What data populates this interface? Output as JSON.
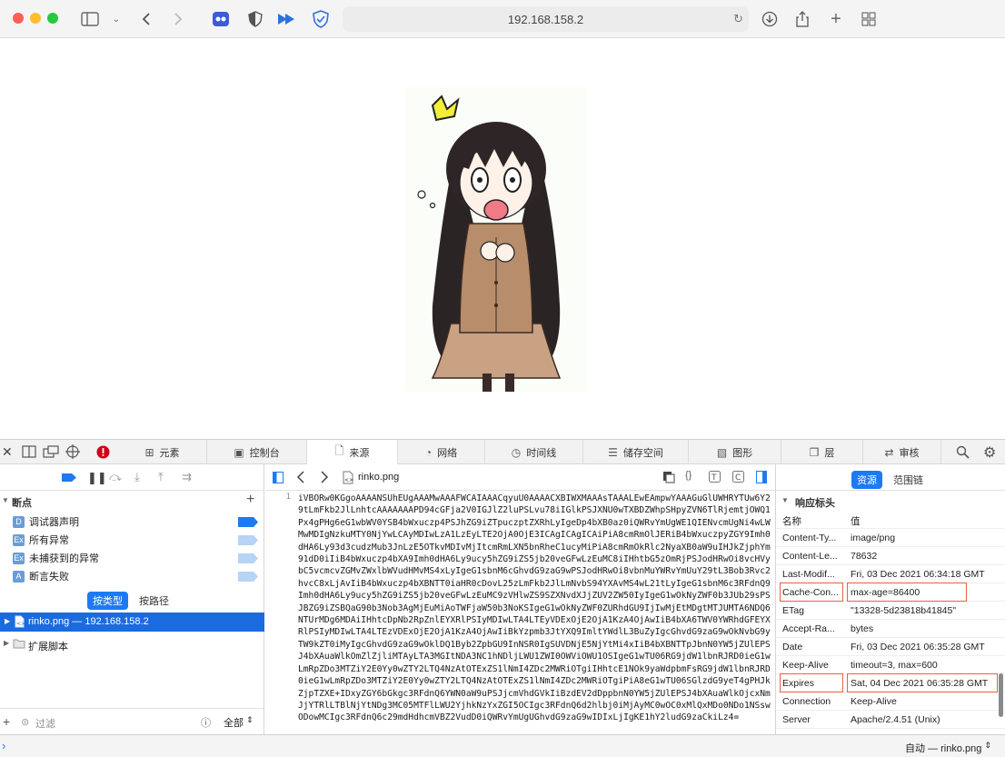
{
  "browser": {
    "url": "192.168.158.2"
  },
  "devtools": {
    "tabs": [
      {
        "label": "元素",
        "icon": "elements-icon"
      },
      {
        "label": "控制台",
        "icon": "console-icon"
      },
      {
        "label": "来源",
        "icon": "sources-icon",
        "active": true
      },
      {
        "label": "网络",
        "icon": "network-icon"
      },
      {
        "label": "时间线",
        "icon": "timeline-icon"
      },
      {
        "label": "储存空间",
        "icon": "storage-icon"
      },
      {
        "label": "图形",
        "icon": "graphics-icon"
      },
      {
        "label": "层",
        "icon": "layers-icon"
      },
      {
        "label": "审核",
        "icon": "audit-icon"
      }
    ],
    "sidebar": {
      "breakpoints_title": "断点",
      "breakpoints": [
        {
          "badge": "D",
          "label": "调试器声明",
          "enabled": true
        },
        {
          "badge": "Ex",
          "label": "所有异常",
          "enabled": false
        },
        {
          "badge": "Ex",
          "label": "未捕获到的异常",
          "enabled": false
        },
        {
          "badge": "A",
          "label": "断言失败",
          "enabled": false
        }
      ],
      "group_by_type": "按类型",
      "group_by_path": "按路径",
      "resource": "rinko.png — 192.168.158.2",
      "extension_scripts": "扩展脚本",
      "filter_placeholder": "过滤",
      "scope": "全部"
    },
    "editor": {
      "filename": "rinko.png",
      "line_number": "1",
      "content": "iVBORw0KGgoAAAANSUhEUgAAAMwAAAFWCAIAAACqyuU0AAAACXBIWXMAAAsTAAALEwEAmpwYAAAGuGlUWHRYTUw6Y29tLmFkb2JlLnhtcAAAAAAAPD94cGFja2V0IGJlZ2luPSLvu78iIGlkPSJXNU0wTXBDZWhpSHpyZVN6TlRjemtjOWQ1Px4gPHg6eG1wbWV0YSB4bWxuczp4PSJhZG9iZTpuczptZXRhLyIgeDp4bXB0az0iQWRvYmUgWE1QIENvcmUgNi4wLWMwMDIgNzkuMTY0NjYwLCAyMDIwLzA1LzEyLTE2OjA0OjE3ICAgICAgICAiPiA8cmRmOlJERiB4bWxuczpyZGY9Imh0dHA6Ly93d3cudzMub3JnLzE5OTkvMDIvMjItcmRmLXN5bnRheC1ucyMiPiA8cmRmOkRlc2NyaXB0aW9uIHJkZjphYm91dD0iIiB4bWxuczp4bXA9Imh0dHA6Ly9ucy5hZG9iZS5jb20veGFwLzEuMC8iIHhtbG5zOmRjPSJodHRwOi8vcHVybC5vcmcvZGMvZWxlbWVudHMvMS4xLyIgeG1sbnM6cGhvdG9zaG9wPSJodHRwOi8vbnMuYWRvYmUuY29tL3Bob3Rvc2hvcC8xLjAvIiB4bWxuczp4bXBNTT0iaHR0cDovL25zLmFkb2JlLmNvbS94YXAvMS4wL21tLyIgeG1sbnM6c3RFdnQ9Imh0dHA6Ly9ucy5hZG9iZS5jb20veGFwLzEuMC9zVHlwZS9SZXNvdXJjZUV2ZW50IyIgeG1wOkNyZWF0b3JUb29sPSJBZG9iZSBQaG90b3Nob3AgMjEuMiAoTWFjaW50b3NoKSIgeG1wOkNyZWF0ZURhdGU9IjIwMjEtMDgtMTJUMTA6NDQ6NTUrMDg6MDAiIHhtcDpNb2RpZnlEYXRlPSIyMDIwLTA4LTEyVDExOjE2OjA1KzA4OjAwIiB4bXA6TWV0YWRhdGFEYXRlPSIyMDIwLTA4LTEzVDExOjE2OjA1KzA4OjAwIiBkYzpmb3JtYXQ9ImltYWdlL3BuZyIgcGhvdG9zaG9wOkNvbG9yTW9kZT0iMyIgcGhvdG9zaG9wOklDQ1Byb2ZpbGU9InNSR0IgSUVDNjE5NjYtMi4xIiB4bXBNTTpJbnN0YW5jZUlEPSJ4bXAuaWlkOmZlZjliMTAyLTA3MGItNDA3NC1hNDljLWU1ZWI0OWViOWU1OSIgeG1wTU06RG9jdW1lbnRJRD0ieG1wLmRpZDo3MTZiY2E0Yy0wZTY2LTQ4NzAtOTExZS1lNmI4ZDc2MWRiOTgiIHhtcE1NOk9yaWdpbmFsRG9jdW1lbnRJRD0ieG1wLmRpZDo3MTZiY2E0Yy0wZTY2LTQ4NzAtOTExZS1lNmI4ZDc2MWRiOTgiPiA8eG1wTU06SGlzdG9yeT4gPHJkZjpTZXE+IDxyZGY6bGkgc3RFdnQ6YWN0aW9uPSJjcmVhdGVkIiBzdEV2dDppbnN0YW5jZUlEPSJ4bXAuaWlkOjcxNmJjYTRlLTBlNjYtNDg3MC05MTFlLWU2YjhkNzYxZGI5OCIgc3RFdnQ6d2hlbj0iMjAyMC0wOC0xMlQxMDo0NDo1NSswODowMCIgc3RFdnQ6c29mdHdhcmVBZ2VudD0iQWRvYmUgUGhvdG9zaG9wIDIxLjIgKE1hY2ludG9zaCkiLz4="
    },
    "details": {
      "tab_resource": "资源",
      "tab_scope": "范围链",
      "section_title": "响应标头",
      "col_name": "名称",
      "col_value": "值",
      "headers": [
        {
          "name": "Content-Ty...",
          "value": "image/png"
        },
        {
          "name": "Content-Le...",
          "value": "78632"
        },
        {
          "name": "Last-Modif...",
          "value": "Fri, 03 Dec 2021 06:34:18 GMT"
        },
        {
          "name": "Cache-Con...",
          "value": "max-age=86400",
          "highlight": true
        },
        {
          "name": "ETag",
          "value": "\"13328-5d23818b41845\""
        },
        {
          "name": "Accept-Ra...",
          "value": "bytes"
        },
        {
          "name": "Date",
          "value": "Fri, 03 Dec 2021 06:35:28 GMT"
        },
        {
          "name": "Keep-Alive",
          "value": "timeout=3, max=600"
        },
        {
          "name": "Expires",
          "value": "Sat, 04 Dec 2021 06:35:28 GMT",
          "highlight": true
        },
        {
          "name": "Connection",
          "value": "Keep-Alive"
        },
        {
          "name": "Server",
          "value": "Apache/2.4.51 (Unix)"
        }
      ]
    },
    "status": {
      "context": "自动 — rinko.png"
    }
  },
  "colors": {
    "accent": "#1d7af3",
    "highlight_box": "#e8623e",
    "error_red": "#d0021b"
  }
}
